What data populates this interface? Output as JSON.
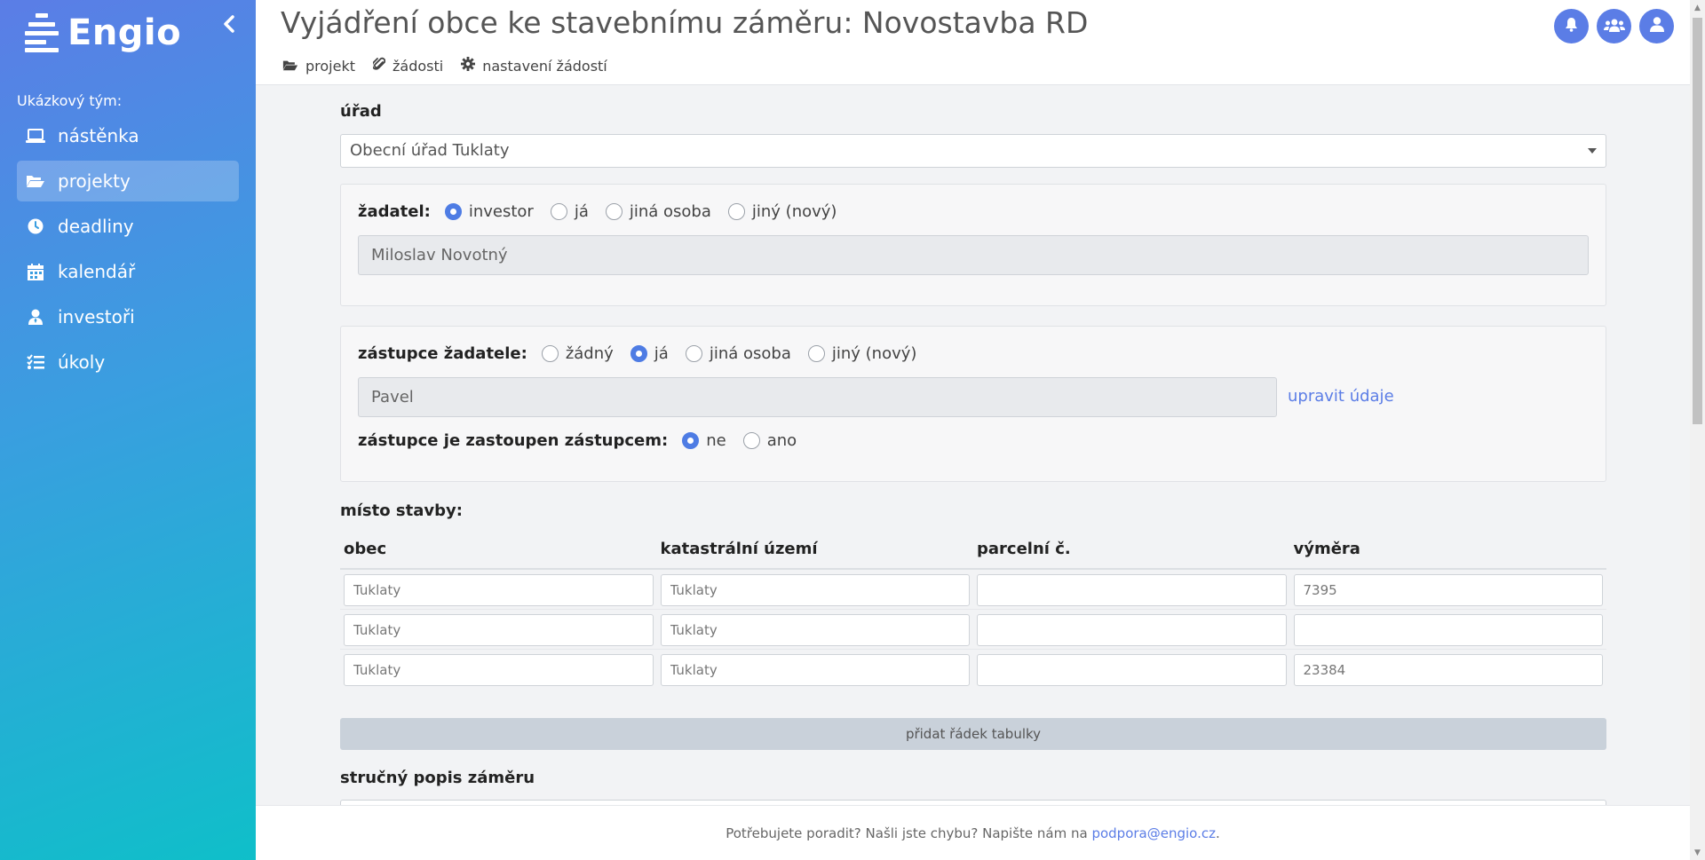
{
  "sidebar": {
    "logo_text": "Engio",
    "team_label": "Ukázkový tým:",
    "items": [
      {
        "label": "nástěnka",
        "icon": "laptop-icon"
      },
      {
        "label": "projekty",
        "icon": "folder-open-icon",
        "active": true
      },
      {
        "label": "deadliny",
        "icon": "clock-icon"
      },
      {
        "label": "kalendář",
        "icon": "calendar-icon"
      },
      {
        "label": "investoři",
        "icon": "user-tie-icon"
      },
      {
        "label": "úkoly",
        "icon": "task-list-icon"
      }
    ]
  },
  "header": {
    "title": "Vyjádření obce ke stavebnímu záměru: Novostavba RD",
    "subnav": [
      {
        "label": "projekt",
        "icon": "folder-open-icon"
      },
      {
        "label": "žádosti",
        "icon": "paperclip-icon"
      },
      {
        "label": "nastavení žádostí",
        "icon": "gear-icon"
      }
    ],
    "icons": [
      "bell-icon",
      "users-icon",
      "user-icon"
    ],
    "accent_color": "#5b7de6"
  },
  "form": {
    "office_label": "úřad",
    "office_value": "Obecní úřad Tuklaty",
    "applicant": {
      "label": "žadatel:",
      "options": [
        "investor",
        "já",
        "jiná osoba",
        "jiný (nový)"
      ],
      "selected": "investor",
      "value": "Miloslav Novotný"
    },
    "representative": {
      "label": "zástupce žadatele:",
      "options": [
        "žádný",
        "já",
        "jiná osoba",
        "jiný (nový)"
      ],
      "selected": "já",
      "value": "Pavel",
      "edit_link": "upravit údaje",
      "sub_label": "zástupce je zastoupen zástupcem:",
      "sub_options": [
        "ne",
        "ano"
      ],
      "sub_selected": "ne"
    },
    "place": {
      "label": "místo stavby:",
      "columns": [
        "obec",
        "katastrální území",
        "parcelní č.",
        "výměra"
      ],
      "rows": [
        [
          "Tuklaty",
          "Tuklaty",
          "",
          "7395"
        ],
        [
          "Tuklaty",
          "Tuklaty",
          "",
          ""
        ],
        [
          "Tuklaty",
          "Tuklaty",
          "",
          "23384"
        ]
      ],
      "add_row_label": "přidat řádek tabulky"
    },
    "description_label": "stručný popis záměru"
  },
  "footer": {
    "text": "Potřebujete poradit? Našli jste chybu? Napište nám na ",
    "email": "podpora@engio.cz",
    "end": "."
  }
}
